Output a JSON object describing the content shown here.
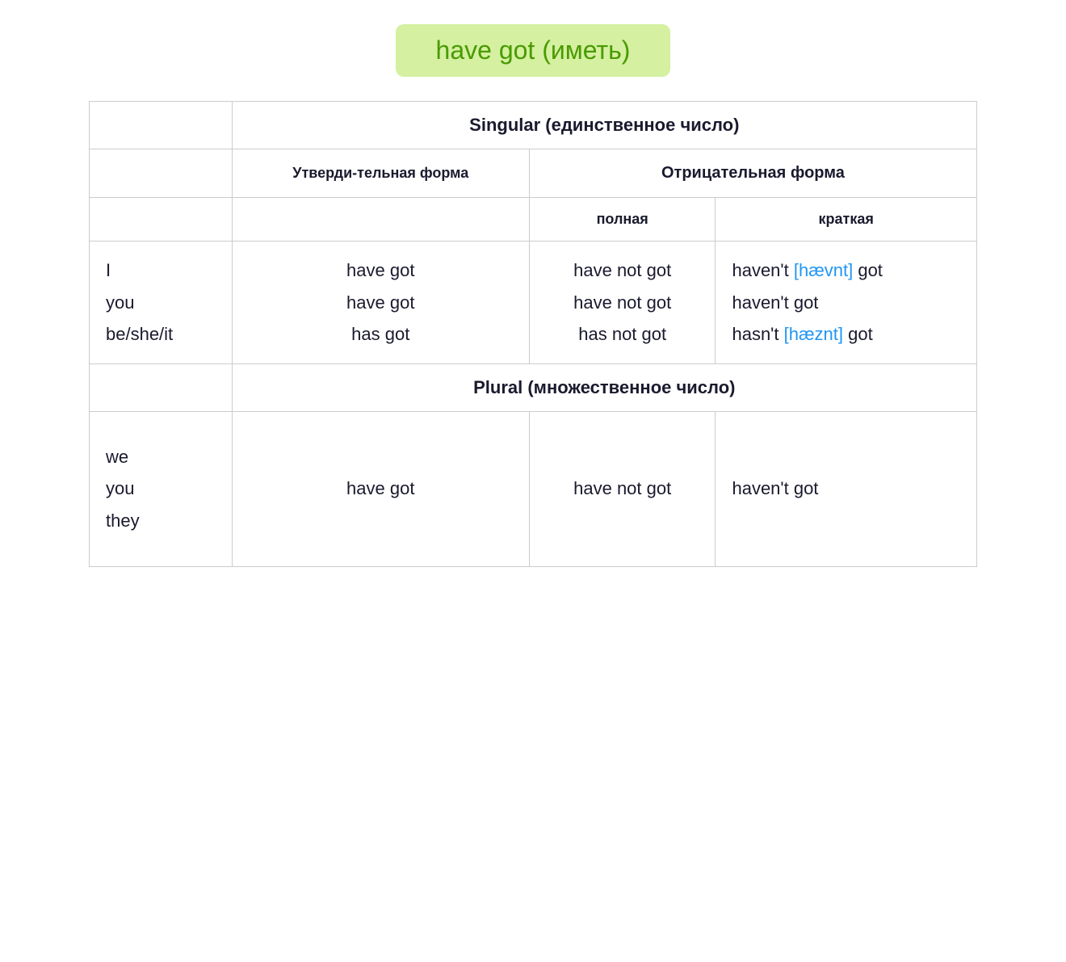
{
  "title": "have got (иметь)",
  "titleColor": "#4a9a00",
  "titleBg": "#d4f0a0",
  "table": {
    "singular_label": "Singular (единственное число)",
    "plural_label": "Plural (множественное число)",
    "affirm_label": "Утверди-тельная форма",
    "negative_label": "Отрицательная форма",
    "full_label": "полная",
    "short_label": "краткая",
    "singular_rows": [
      {
        "pronoun": "I",
        "affirm": "have got",
        "negative_full": "have not got",
        "negative_short": "haven't",
        "phonetic": "[hævnt]",
        "neg_short_suffix": "got"
      },
      {
        "pronoun": "you",
        "affirm": "have got",
        "negative_full": "have not got",
        "negative_short": "haven't got",
        "phonetic": "",
        "neg_short_suffix": ""
      },
      {
        "pronoun": "be/she/it",
        "affirm": "has got",
        "negative_full": "has not got",
        "negative_short": "hasn't",
        "phonetic": "[hæznt]",
        "neg_short_suffix": "got"
      }
    ],
    "plural_pronouns": "we\nyou\nthey",
    "plural_affirm": "have got",
    "plural_neg_full": "have not got",
    "plural_neg_short": "haven't got"
  }
}
